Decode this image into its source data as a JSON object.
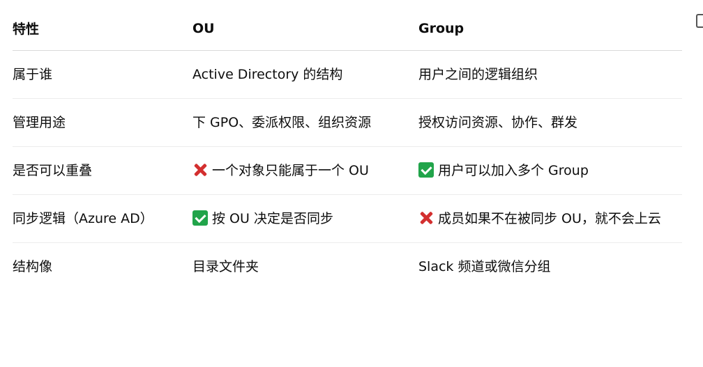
{
  "table": {
    "headers": [
      "特性",
      "OU",
      "Group"
    ],
    "rows": [
      {
        "feature": "属于谁",
        "ou": "Active Directory 的结构",
        "group": "用户之间的逻辑组织",
        "ou_mark": "",
        "group_mark": ""
      },
      {
        "feature": "管理用途",
        "ou": "下 GPO、委派权限、组织资源",
        "group": "授权访问资源、协作、群发",
        "ou_mark": "",
        "group_mark": ""
      },
      {
        "feature": "是否可以重叠",
        "ou": "一个对象只能属于一个 OU",
        "group": "用户可以加入多个 Group",
        "ou_mark": "cross-mark-icon",
        "group_mark": "check-mark-icon"
      },
      {
        "feature": "同步逻辑（Azure AD）",
        "ou": "按 OU 决定是否同步",
        "group": "成员如果不在被同步 OU，就不会上云",
        "ou_mark": "check-mark-icon",
        "group_mark": "cross-mark-icon"
      },
      {
        "feature": "结构像",
        "ou": "目录文件夹",
        "group": "Slack 频道或微信分组",
        "ou_mark": "",
        "group_mark": ""
      }
    ]
  },
  "icons": {
    "copy": "copy-icon"
  },
  "colors": {
    "cross": "#d32f2f",
    "check": "#21a44a",
    "divider": "#ececec"
  }
}
